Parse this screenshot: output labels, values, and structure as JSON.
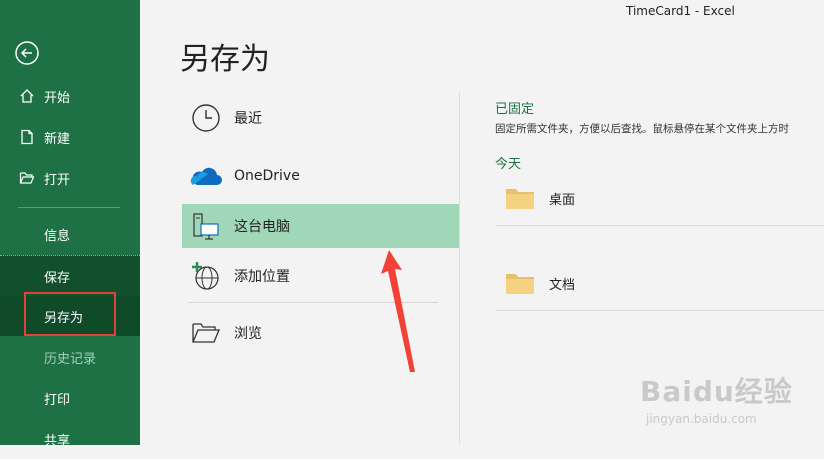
{
  "window": {
    "title": "TimeCard1  -  Excel"
  },
  "sidebar": {
    "items": [
      {
        "label": "开始"
      },
      {
        "label": "新建"
      },
      {
        "label": "打开"
      },
      {
        "label": "信息"
      },
      {
        "label": "保存"
      },
      {
        "label": "另存为"
      },
      {
        "label": "历史记录"
      },
      {
        "label": "打印"
      },
      {
        "label": "共享"
      }
    ]
  },
  "main": {
    "title": "另存为",
    "locations": [
      {
        "label": "最近",
        "icon": "clock-icon"
      },
      {
        "label": "OneDrive",
        "icon": "cloud-icon"
      },
      {
        "label": "这台电脑",
        "icon": "computer-icon"
      },
      {
        "label": "添加位置",
        "icon": "globe-add-icon"
      },
      {
        "label": "浏览",
        "icon": "folder-open-icon"
      }
    ],
    "pinned": {
      "heading": "已固定",
      "description": "固定所需文件夹，方便以后查找。鼠标悬停在某个文件夹上方时"
    },
    "today": {
      "heading": "今天",
      "folders": [
        {
          "label": "桌面"
        },
        {
          "label": "文档"
        }
      ]
    }
  },
  "watermark": {
    "brand": "Baidu经验",
    "url": "jingyan.baidu.com"
  },
  "colors": {
    "sidebar": "#1e7145",
    "selected_location": "#a1d7b9",
    "annotation": "#e0433b",
    "heading": "#1e7145"
  }
}
